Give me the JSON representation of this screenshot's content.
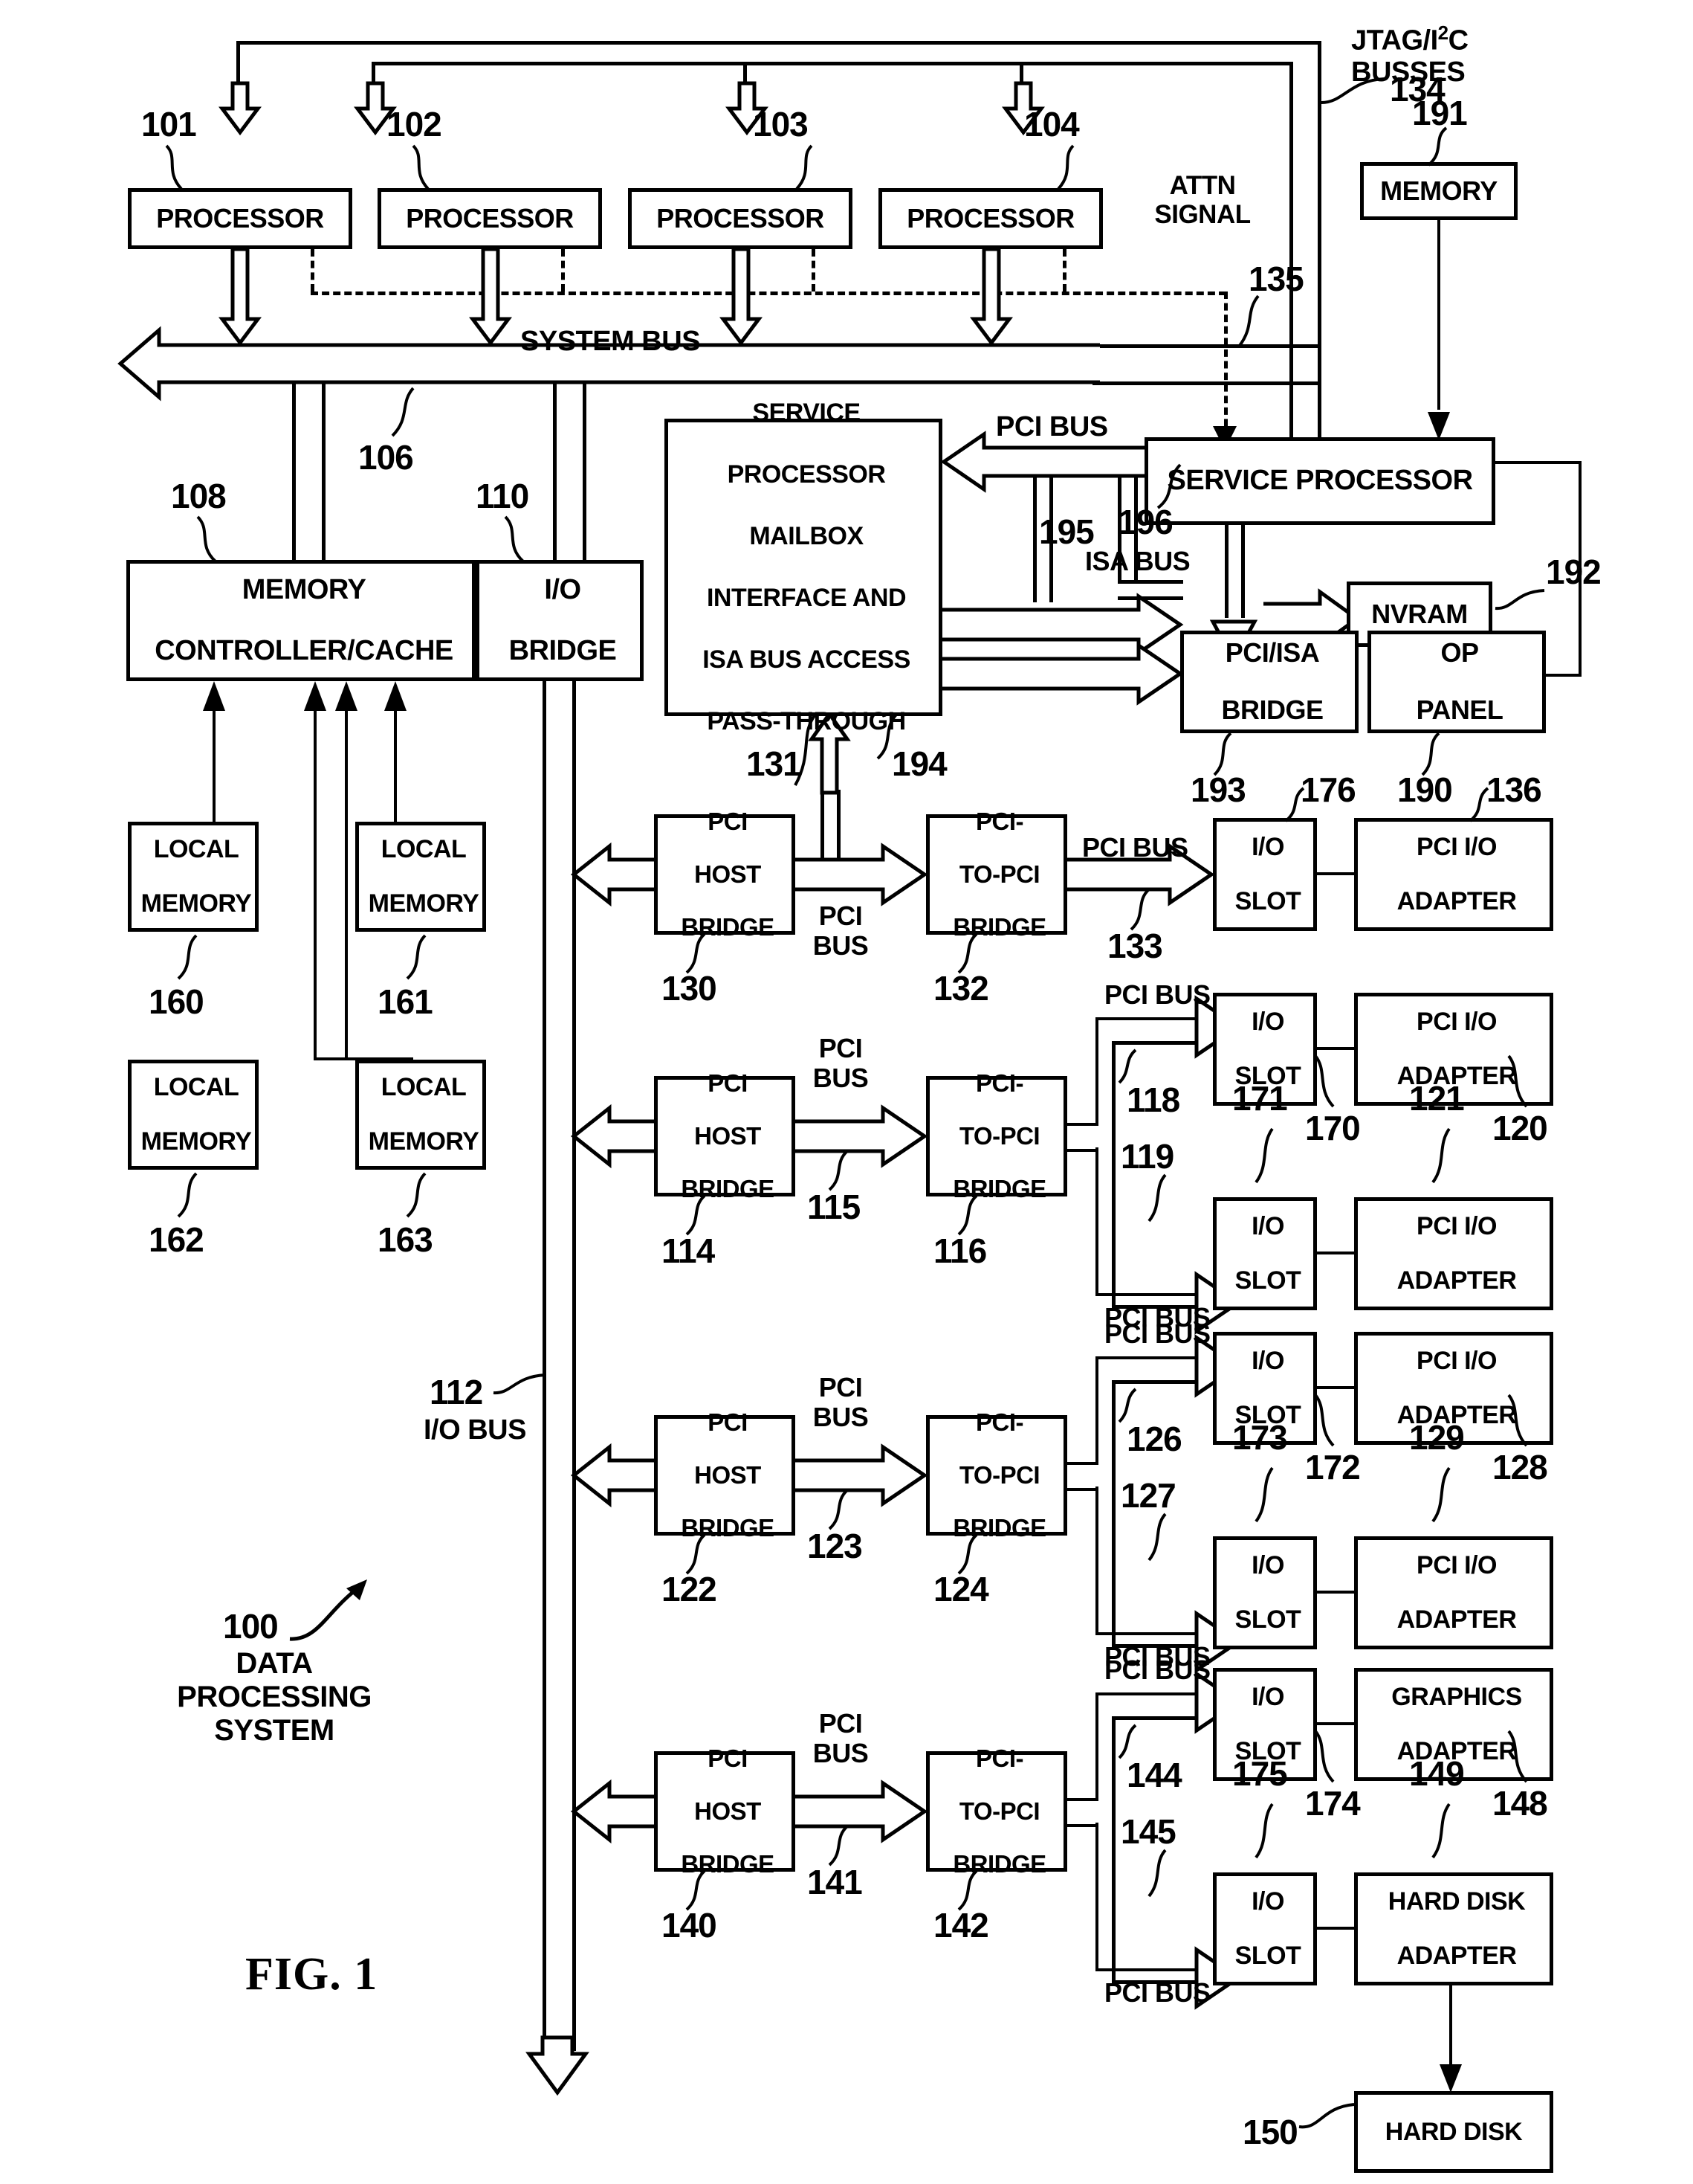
{
  "figure": {
    "caption": "FIG. 1",
    "system_numeral": "100",
    "system_label_line1": "DATA",
    "system_label_line2": "PROCESSING",
    "system_label_line3": "SYSTEM"
  },
  "processors": [
    {
      "label": "PROCESSOR",
      "numeral": "101"
    },
    {
      "label": "PROCESSOR",
      "numeral": "102"
    },
    {
      "label": "PROCESSOR",
      "numeral": "103"
    },
    {
      "label": "PROCESSOR",
      "numeral": "104"
    }
  ],
  "buses": {
    "system_bus": "SYSTEM BUS",
    "system_bus_numeral": "106",
    "io_bus": "I/O BUS",
    "io_bus_numeral": "112",
    "jtag_line1": "JTAG/I",
    "jtag_sup": "2",
    "jtag_line1b": "C",
    "jtag_line2": "BUSSES",
    "jtag_numeral": "134",
    "attn_line1": "ATTN",
    "attn_line2": "SIGNAL",
    "attn_numeral": "135",
    "isa_bus": "ISA BUS",
    "isa_numeral": "196",
    "mailbox_bus_numeral": "195",
    "pci_bus": "PCI BUS",
    "pci": "PCI",
    "bus": "BUS"
  },
  "memory": {
    "controller_line1": "MEMORY",
    "controller_line2": "CONTROLLER/CACHE",
    "controller_numeral": "108",
    "io_bridge_line1": "I/O",
    "io_bridge_line2": "BRIDGE",
    "io_bridge_numeral": "110",
    "local_label_line1": "LOCAL",
    "local_label_line2": "MEMORY",
    "local_numerals": [
      "160",
      "161",
      "162",
      "163"
    ],
    "sp_memory": "MEMORY",
    "sp_memory_numeral": "191"
  },
  "service": {
    "mailbox_lines": [
      "SERVICE",
      "PROCESSOR",
      "MAILBOX",
      "INTERFACE AND",
      "ISA BUS ACCESS",
      "PASS-THROUGH"
    ],
    "mailbox_numeral_left": "131",
    "mailbox_numeral_right": "194",
    "processor_label": "SERVICE PROCESSOR",
    "nvram_label": "NVRAM",
    "nvram_numeral": "192",
    "pci_isa_line1": "PCI/ISA",
    "pci_isa_line2": "BRIDGE",
    "pci_isa_numeral": "193",
    "op_panel_line1": "OP",
    "op_panel_line2": "PANEL",
    "op_panel_numeral": "190"
  },
  "host_bridge": {
    "line1": "PCI",
    "line2": "HOST",
    "line3": "BRIDGE"
  },
  "ptp_bridge": {
    "line1": "PCI-",
    "line2": "TO-PCI",
    "line3": "BRIDGE"
  },
  "io_slot": {
    "line1": "I/O",
    "line2": "SLOT"
  },
  "adapter_pci": {
    "line1": "PCI I/O",
    "line2": "ADAPTER"
  },
  "adapter_graphics": {
    "line1": "GRAPHICS",
    "line2": "ADAPTER"
  },
  "adapter_hdd": {
    "line1": "HARD DISK",
    "line2": "ADAPTER"
  },
  "hard_disk": {
    "label": "HARD DISK",
    "numeral": "150"
  },
  "rows": [
    {
      "host_numeral": "130",
      "mid_bus_numeral": "",
      "ptp_numeral": "132",
      "slots": [
        {
          "bus_numeral": "133",
          "slot_numeral": "176",
          "adapter_numeral": "136",
          "slot_ref": "",
          "adapter_ref": ""
        }
      ]
    },
    {
      "host_numeral": "114",
      "mid_bus_numeral": "115",
      "ptp_numeral": "116",
      "slots": [
        {
          "bus_numeral": "118",
          "slot_numeral": "171",
          "adapter_numeral": "121"
        },
        {
          "bus_numeral": "119",
          "slot_numeral": "170",
          "adapter_numeral": "120"
        }
      ]
    },
    {
      "host_numeral": "122",
      "mid_bus_numeral": "123",
      "ptp_numeral": "124",
      "slots": [
        {
          "bus_numeral": "126",
          "slot_numeral": "173",
          "adapter_numeral": "129"
        },
        {
          "bus_numeral": "127",
          "slot_numeral": "172",
          "adapter_numeral": "128"
        }
      ]
    },
    {
      "host_numeral": "140",
      "mid_bus_numeral": "141",
      "ptp_numeral": "142",
      "slots": [
        {
          "bus_numeral": "144",
          "slot_numeral": "175",
          "adapter_numeral": "149"
        },
        {
          "bus_numeral": "145",
          "slot_numeral": "174",
          "adapter_numeral": "148"
        }
      ]
    }
  ]
}
